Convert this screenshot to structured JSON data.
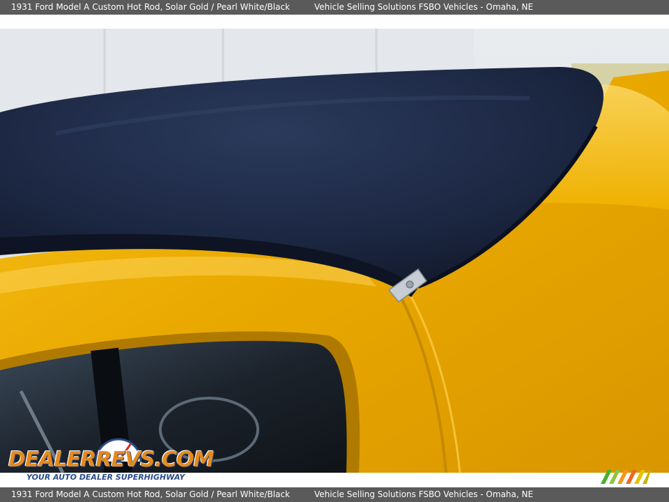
{
  "header": {
    "vehicle": "1931 Ford Model A Custom Hot Rod,  Solar Gold / Pearl White/Black",
    "seller": "Vehicle Selling Solutions FSBO Vehicles - Omaha, NE"
  },
  "footer": {
    "vehicle": "1931 Ford Model A Custom Hot Rod,  Solar Gold / Pearl White/Black",
    "seller": "Vehicle Selling Solutions FSBO Vehicles - Omaha, NE"
  },
  "watermark": {
    "brand": "DEALERREVS.COM",
    "tagline": "YOUR AUTO DEALER SUPERHIGHWAY"
  },
  "colors": {
    "bar": "#5a5a5a",
    "paint_gold": "#f0b400",
    "top_navy": "#1e2a44"
  },
  "icons": [
    "gauge-icon",
    "stripe-logo-icon"
  ]
}
